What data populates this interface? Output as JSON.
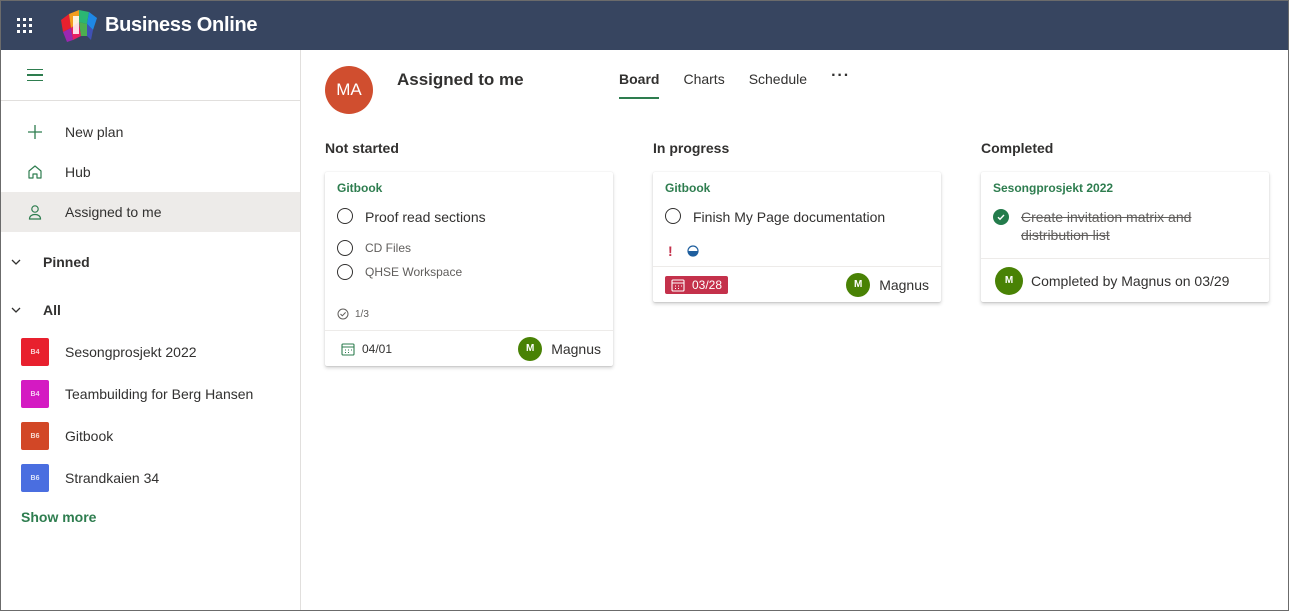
{
  "app": {
    "brand": "Business Online"
  },
  "sidebar": {
    "nav": [
      {
        "label": "New plan",
        "icon": "plus-icon"
      },
      {
        "label": "Hub",
        "icon": "home-icon"
      },
      {
        "label": "Assigned to me",
        "icon": "person-icon",
        "active": true
      }
    ],
    "pinned_label": "Pinned",
    "all_label": "All",
    "plans": [
      {
        "label": "Sesongprosjekt 2022",
        "tile": "B4",
        "color": "#e8202e"
      },
      {
        "label": "Teambuilding for Berg Hansen",
        "tile": "B4",
        "color": "#d41ac2"
      },
      {
        "label": "Gitbook",
        "tile": "B6",
        "color": "#d24726"
      },
      {
        "label": "Strandkaien 34",
        "tile": "B6",
        "color": "#4a6ee0"
      }
    ],
    "show_more": "Show more"
  },
  "header": {
    "avatar_initials": "MA",
    "title": "Assigned to me",
    "tabs": [
      "Board",
      "Charts",
      "Schedule"
    ],
    "more": "···"
  },
  "columns": [
    {
      "title": "Not started",
      "card": {
        "plan": "Gitbook",
        "task": "Proof read sections",
        "checklist": [
          "CD Files",
          "QHSE Workspace"
        ],
        "progress": "1/3",
        "date": "04/01",
        "assignee_initial": "M",
        "assignee": "Magnus"
      }
    },
    {
      "title": "In progress",
      "card": {
        "plan": "Gitbook",
        "task": "Finish My Page documentation",
        "priority_mark": "!",
        "date": "03/28",
        "assignee_initial": "M",
        "assignee": "Magnus"
      }
    },
    {
      "title": "Completed",
      "card": {
        "plan": "Sesongprosjekt 2022",
        "task_line1": "Create invitation matrix and",
        "task_line2": "distribution list",
        "assignee_initial": "M",
        "completed_text": "Completed by Magnus on 03/29"
      }
    }
  ],
  "colors": {
    "accent": "#2e7d4f",
    "topbar": "#374560",
    "late": "#c4314b",
    "avatar_user": "#d04e2f",
    "avatar_assignee": "#498205"
  }
}
